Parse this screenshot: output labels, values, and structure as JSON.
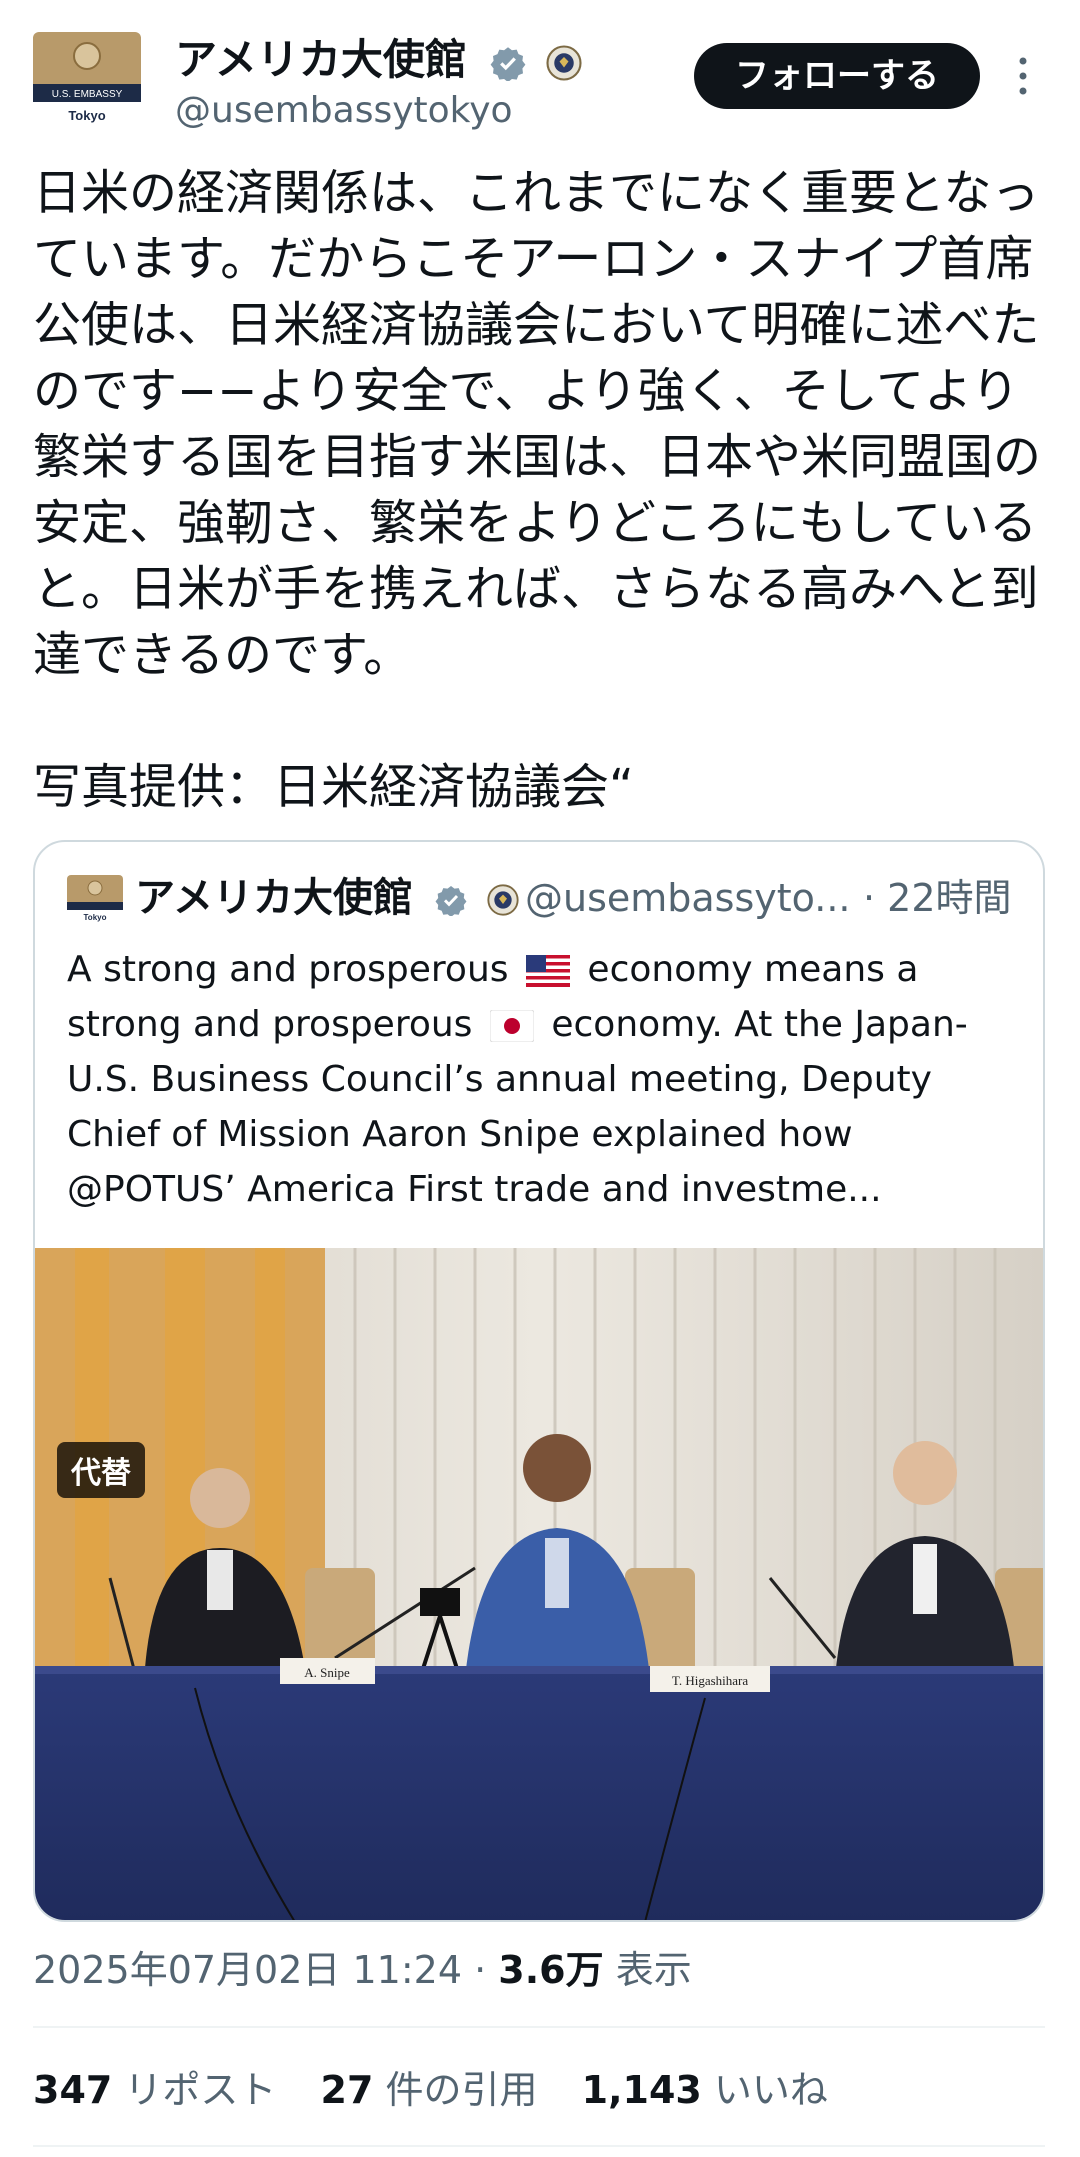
{
  "account": {
    "display_name": "アメリカ大使館",
    "handle": "@usembassytokyo",
    "avatar_text_top": "U.S. EMBASSY",
    "avatar_text_bottom": "Tokyo",
    "follow_label": "フォローする"
  },
  "tweet": {
    "text": "日米の経済関係は、これまでになく重要となっています。だからこそアーロン・スナイプ首席公使は、日米経済協議会において明確に述べたのです−−より安全で、より強く、そしてより繁栄する国を目指す米国は、日本や米同盟国の安定、強靭さ、繁栄をよりどころにもしていると。日米が手を携えれば、さらなる高みへと到達できるのです。\n\n写真提供：日米経済協議会“"
  },
  "quote": {
    "display_name": "アメリカ大使館",
    "handle": "@usembassyto...",
    "time": "· 22時間",
    "text_1": "A strong and prosperous",
    "text_2": "economy means a strong and prosperous",
    "text_3": "economy. At the Japan-U.S. Business Council’s annual meeting, Deputy Chief of Mission Aaron Snipe explained how @POTUS’ America First trade and investme...",
    "alt_label": "代替",
    "nameplates": [
      "A. Snipe",
      "T. Higashihara"
    ]
  },
  "meta": {
    "timestamp": "2025年07月02日 11:24",
    "separator": "·",
    "views": "3.6万",
    "views_label": "表示"
  },
  "stats": {
    "reposts": "347",
    "reposts_label": "リポスト",
    "quotes": "27",
    "quotes_label": "件の引用",
    "likes": "1,143",
    "likes_label": "いいね"
  },
  "colors": {
    "text": "#0f1419",
    "secondary": "#536471",
    "verified": "#829aab",
    "follow_bg": "#0f1419",
    "border": "#cfd9de"
  }
}
